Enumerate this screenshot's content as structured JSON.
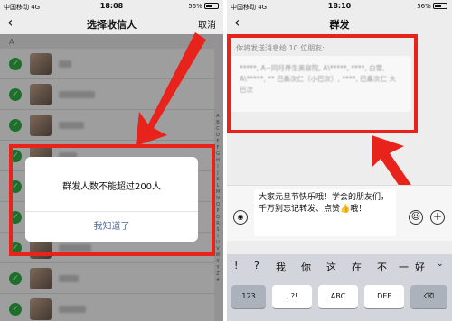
{
  "left_screen": {
    "status": {
      "carrier": "中国移动 4G",
      "time": "18:08",
      "battery": "56%"
    },
    "nav": {
      "back": "‹",
      "title": "选择收信人",
      "action": "取消"
    },
    "section_letter": "A",
    "index_letters": [
      "A",
      "B",
      "C",
      "D",
      "E",
      "F",
      "G",
      "H",
      "I",
      "J",
      "K",
      "L",
      "M",
      "N",
      "O",
      "P",
      "Q",
      "R",
      "S",
      "T",
      "U",
      "V",
      "W",
      "X",
      "Y",
      "Z",
      "#"
    ],
    "dialog": {
      "message": "群发人数不能超过200人",
      "confirm": "我知道了"
    },
    "check_icon": "checkmark-icon",
    "accent": "#2fb544",
    "highlight_color": "#e8231c"
  },
  "right_screen": {
    "status": {
      "carrier": "中国移动 4G",
      "time": "18:10",
      "battery": "56%"
    },
    "nav": {
      "back": "‹",
      "title": "群发"
    },
    "send_hint": "你将发送消息给 10 位朋友:",
    "recipients": "*****, A~同月养生美容院, A\\*****, ****, 白雪, A\\*****, ** 巴桑次仁（小巴次）, ****, 巴桑次仁 大巴次",
    "compose_text": "大家元旦节快乐哦！学会的朋友们，千万别忘记转发、点赞👍哦！",
    "suggestions": [
      "!",
      "?",
      "我",
      "你",
      "这",
      "在",
      "不",
      "一",
      "好",
      "⌄"
    ],
    "keys": {
      "num": "123",
      "punct": ",.?!",
      "abc": "ABC",
      "def": "DEF",
      "delete": "⌫"
    },
    "icons": {
      "voice": "voice-icon",
      "emoji": "emoji-icon",
      "plus": "plus-icon"
    }
  }
}
